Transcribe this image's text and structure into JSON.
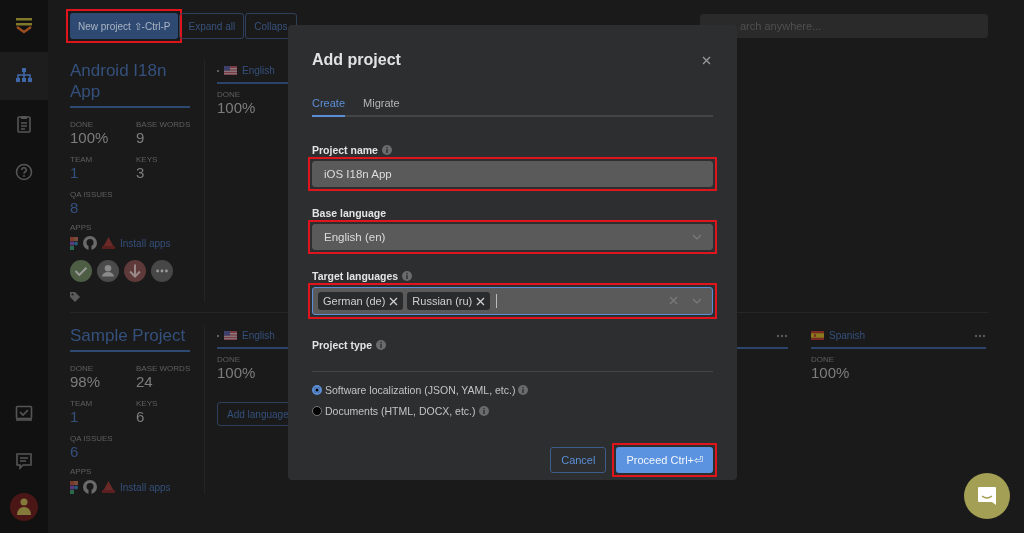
{
  "sidebar": {
    "top_items": [
      {
        "selected": true
      },
      {
        "selected": false
      },
      {
        "selected": false
      }
    ],
    "bottom_items": [
      {
        "selected": false
      },
      {
        "selected": false
      }
    ]
  },
  "toolbar": {
    "buttons": [
      {
        "label": "New project ⇧-Ctrl-P",
        "kind": "primary",
        "highlighted": true
      },
      {
        "label": "Expand all",
        "kind": "outline",
        "highlighted": false
      },
      {
        "label": "Collaps",
        "kind": "outline",
        "highlighted": false
      }
    ],
    "search": {
      "placeholder": "arch anywhere..."
    }
  },
  "projects": [
    {
      "title": "Android I18n App",
      "stats": [
        {
          "label": "DONE",
          "value": "100%",
          "link": false
        },
        {
          "label": "BASE WORDS",
          "value": "9",
          "link": false
        },
        {
          "label": "TEAM",
          "value": "1",
          "link": true
        },
        {
          "label": "KEYS",
          "value": "3",
          "link": false
        },
        {
          "label": "QA ISSUES",
          "value": "8",
          "link": true
        }
      ],
      "apps_label": "APPS",
      "install_link": "Install apps",
      "actions": [
        {
          "kind": "approve",
          "color": "#4d5e45"
        },
        {
          "kind": "member",
          "color": "#4a4a4a"
        },
        {
          "kind": "download",
          "color": "#5e3a3a"
        },
        {
          "kind": "more",
          "color": "#474747"
        }
      ],
      "tag": true,
      "languages": [
        {
          "kind": "us_flag",
          "name": "English",
          "bullet": true,
          "done_label": "DONE",
          "done": "100%"
        }
      ]
    },
    {
      "title": "Sample Project",
      "stats": [
        {
          "label": "DONE",
          "value": "98%",
          "link": false
        },
        {
          "label": "BASE WORDS",
          "value": "24",
          "link": false
        },
        {
          "label": "TEAM",
          "value": "1",
          "link": true
        },
        {
          "label": "KEYS",
          "value": "6",
          "link": false
        },
        {
          "label": "QA ISSUES",
          "value": "6",
          "link": true
        }
      ],
      "apps_label": "APPS",
      "install_link": "Install apps",
      "tag": false,
      "add_language": "Add language",
      "languages": [
        {
          "kind": "us_flag",
          "name": "English",
          "bullet": true,
          "done_label": "DONE",
          "done": "100%"
        },
        {
          "kind": "partial",
          "more": true
        },
        {
          "kind": "es_flag",
          "name": "Spanish",
          "bullet": false,
          "more": true,
          "done_label": "DONE",
          "done": "100%"
        }
      ]
    }
  ],
  "modal": {
    "title": "Add project",
    "tabs": [
      {
        "label": "Create",
        "selected": true
      },
      {
        "label": "Migrate",
        "selected": false
      }
    ],
    "fields": [
      {
        "kind": "text",
        "label": "Project name",
        "info": true,
        "value": "iOS I18n App",
        "highlighted": true
      },
      {
        "kind": "select",
        "label": "Base language",
        "info": false,
        "value": "English (en)",
        "highlighted": true
      },
      {
        "kind": "multi",
        "label": "Target languages",
        "info": true,
        "tags": [
          "German (de)",
          "Russian (ru)"
        ],
        "focused": true,
        "highlighted": true
      }
    ],
    "project_type": {
      "label": "Project type",
      "options": [
        {
          "label": "Software localization (JSON, YAML, etc.)",
          "selected": true
        },
        {
          "label": "Documents (HTML, DOCX, etc.)",
          "selected": false
        }
      ]
    },
    "buttons": [
      {
        "label": "Cancel",
        "kind": "outline",
        "highlighted": false
      },
      {
        "label": "Proceed Ctrl+⏎",
        "kind": "primary",
        "highlighted": true
      }
    ]
  }
}
